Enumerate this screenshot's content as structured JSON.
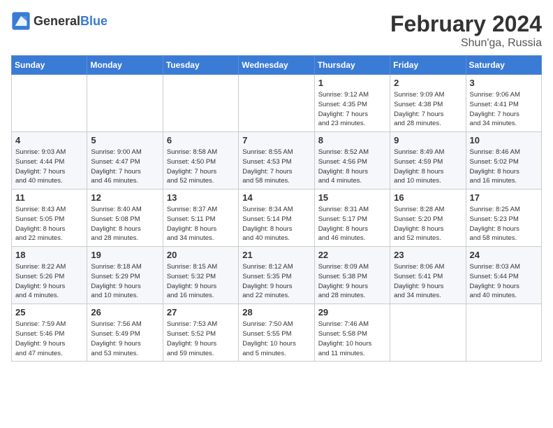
{
  "header": {
    "logo_general": "General",
    "logo_blue": "Blue",
    "month_year": "February 2024",
    "location": "Shun'ga, Russia"
  },
  "weekdays": [
    "Sunday",
    "Monday",
    "Tuesday",
    "Wednesday",
    "Thursday",
    "Friday",
    "Saturday"
  ],
  "weeks": [
    [
      {
        "day": "",
        "info": ""
      },
      {
        "day": "",
        "info": ""
      },
      {
        "day": "",
        "info": ""
      },
      {
        "day": "",
        "info": ""
      },
      {
        "day": "1",
        "info": "Sunrise: 9:12 AM\nSunset: 4:35 PM\nDaylight: 7 hours\nand 23 minutes."
      },
      {
        "day": "2",
        "info": "Sunrise: 9:09 AM\nSunset: 4:38 PM\nDaylight: 7 hours\nand 28 minutes."
      },
      {
        "day": "3",
        "info": "Sunrise: 9:06 AM\nSunset: 4:41 PM\nDaylight: 7 hours\nand 34 minutes."
      }
    ],
    [
      {
        "day": "4",
        "info": "Sunrise: 9:03 AM\nSunset: 4:44 PM\nDaylight: 7 hours\nand 40 minutes."
      },
      {
        "day": "5",
        "info": "Sunrise: 9:00 AM\nSunset: 4:47 PM\nDaylight: 7 hours\nand 46 minutes."
      },
      {
        "day": "6",
        "info": "Sunrise: 8:58 AM\nSunset: 4:50 PM\nDaylight: 7 hours\nand 52 minutes."
      },
      {
        "day": "7",
        "info": "Sunrise: 8:55 AM\nSunset: 4:53 PM\nDaylight: 7 hours\nand 58 minutes."
      },
      {
        "day": "8",
        "info": "Sunrise: 8:52 AM\nSunset: 4:56 PM\nDaylight: 8 hours\nand 4 minutes."
      },
      {
        "day": "9",
        "info": "Sunrise: 8:49 AM\nSunset: 4:59 PM\nDaylight: 8 hours\nand 10 minutes."
      },
      {
        "day": "10",
        "info": "Sunrise: 8:46 AM\nSunset: 5:02 PM\nDaylight: 8 hours\nand 16 minutes."
      }
    ],
    [
      {
        "day": "11",
        "info": "Sunrise: 8:43 AM\nSunset: 5:05 PM\nDaylight: 8 hours\nand 22 minutes."
      },
      {
        "day": "12",
        "info": "Sunrise: 8:40 AM\nSunset: 5:08 PM\nDaylight: 8 hours\nand 28 minutes."
      },
      {
        "day": "13",
        "info": "Sunrise: 8:37 AM\nSunset: 5:11 PM\nDaylight: 8 hours\nand 34 minutes."
      },
      {
        "day": "14",
        "info": "Sunrise: 8:34 AM\nSunset: 5:14 PM\nDaylight: 8 hours\nand 40 minutes."
      },
      {
        "day": "15",
        "info": "Sunrise: 8:31 AM\nSunset: 5:17 PM\nDaylight: 8 hours\nand 46 minutes."
      },
      {
        "day": "16",
        "info": "Sunrise: 8:28 AM\nSunset: 5:20 PM\nDaylight: 8 hours\nand 52 minutes."
      },
      {
        "day": "17",
        "info": "Sunrise: 8:25 AM\nSunset: 5:23 PM\nDaylight: 8 hours\nand 58 minutes."
      }
    ],
    [
      {
        "day": "18",
        "info": "Sunrise: 8:22 AM\nSunset: 5:26 PM\nDaylight: 9 hours\nand 4 minutes."
      },
      {
        "day": "19",
        "info": "Sunrise: 8:18 AM\nSunset: 5:29 PM\nDaylight: 9 hours\nand 10 minutes."
      },
      {
        "day": "20",
        "info": "Sunrise: 8:15 AM\nSunset: 5:32 PM\nDaylight: 9 hours\nand 16 minutes."
      },
      {
        "day": "21",
        "info": "Sunrise: 8:12 AM\nSunset: 5:35 PM\nDaylight: 9 hours\nand 22 minutes."
      },
      {
        "day": "22",
        "info": "Sunrise: 8:09 AM\nSunset: 5:38 PM\nDaylight: 9 hours\nand 28 minutes."
      },
      {
        "day": "23",
        "info": "Sunrise: 8:06 AM\nSunset: 5:41 PM\nDaylight: 9 hours\nand 34 minutes."
      },
      {
        "day": "24",
        "info": "Sunrise: 8:03 AM\nSunset: 5:44 PM\nDaylight: 9 hours\nand 40 minutes."
      }
    ],
    [
      {
        "day": "25",
        "info": "Sunrise: 7:59 AM\nSunset: 5:46 PM\nDaylight: 9 hours\nand 47 minutes."
      },
      {
        "day": "26",
        "info": "Sunrise: 7:56 AM\nSunset: 5:49 PM\nDaylight: 9 hours\nand 53 minutes."
      },
      {
        "day": "27",
        "info": "Sunrise: 7:53 AM\nSunset: 5:52 PM\nDaylight: 9 hours\nand 59 minutes."
      },
      {
        "day": "28",
        "info": "Sunrise: 7:50 AM\nSunset: 5:55 PM\nDaylight: 10 hours\nand 5 minutes."
      },
      {
        "day": "29",
        "info": "Sunrise: 7:46 AM\nSunset: 5:58 PM\nDaylight: 10 hours\nand 11 minutes."
      },
      {
        "day": "",
        "info": ""
      },
      {
        "day": "",
        "info": ""
      }
    ]
  ]
}
